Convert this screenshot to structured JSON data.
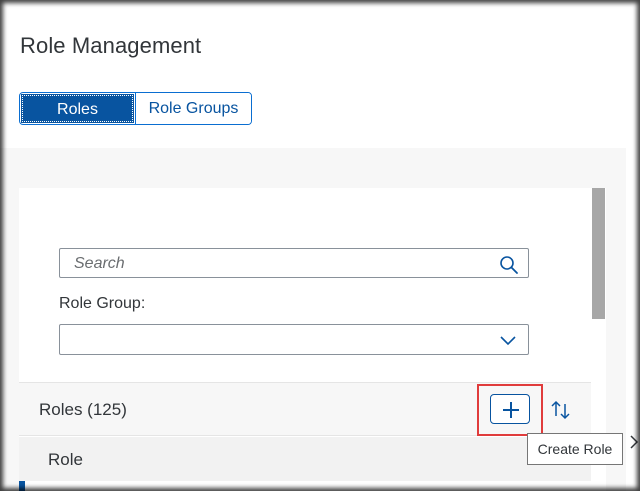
{
  "page": {
    "title": "Role Management"
  },
  "tabs": [
    {
      "label": "Roles",
      "active": true
    },
    {
      "label": "Role Groups",
      "active": false
    }
  ],
  "filters": {
    "search": {
      "placeholder": "Search",
      "value": "",
      "icon": "search-icon"
    },
    "role_group": {
      "label": "Role Group:",
      "value": "",
      "icon": "chevron-down-icon"
    }
  },
  "roles_toolbar": {
    "title": "Roles (125)",
    "add_icon": "plus-icon",
    "sort_icon": "sort-icon"
  },
  "table": {
    "columns": [
      "Role"
    ]
  },
  "tooltip": {
    "text": "Create Role"
  },
  "colors": {
    "accent": "#0854a0",
    "highlight": "#e03c3c",
    "border": "#89919a"
  }
}
